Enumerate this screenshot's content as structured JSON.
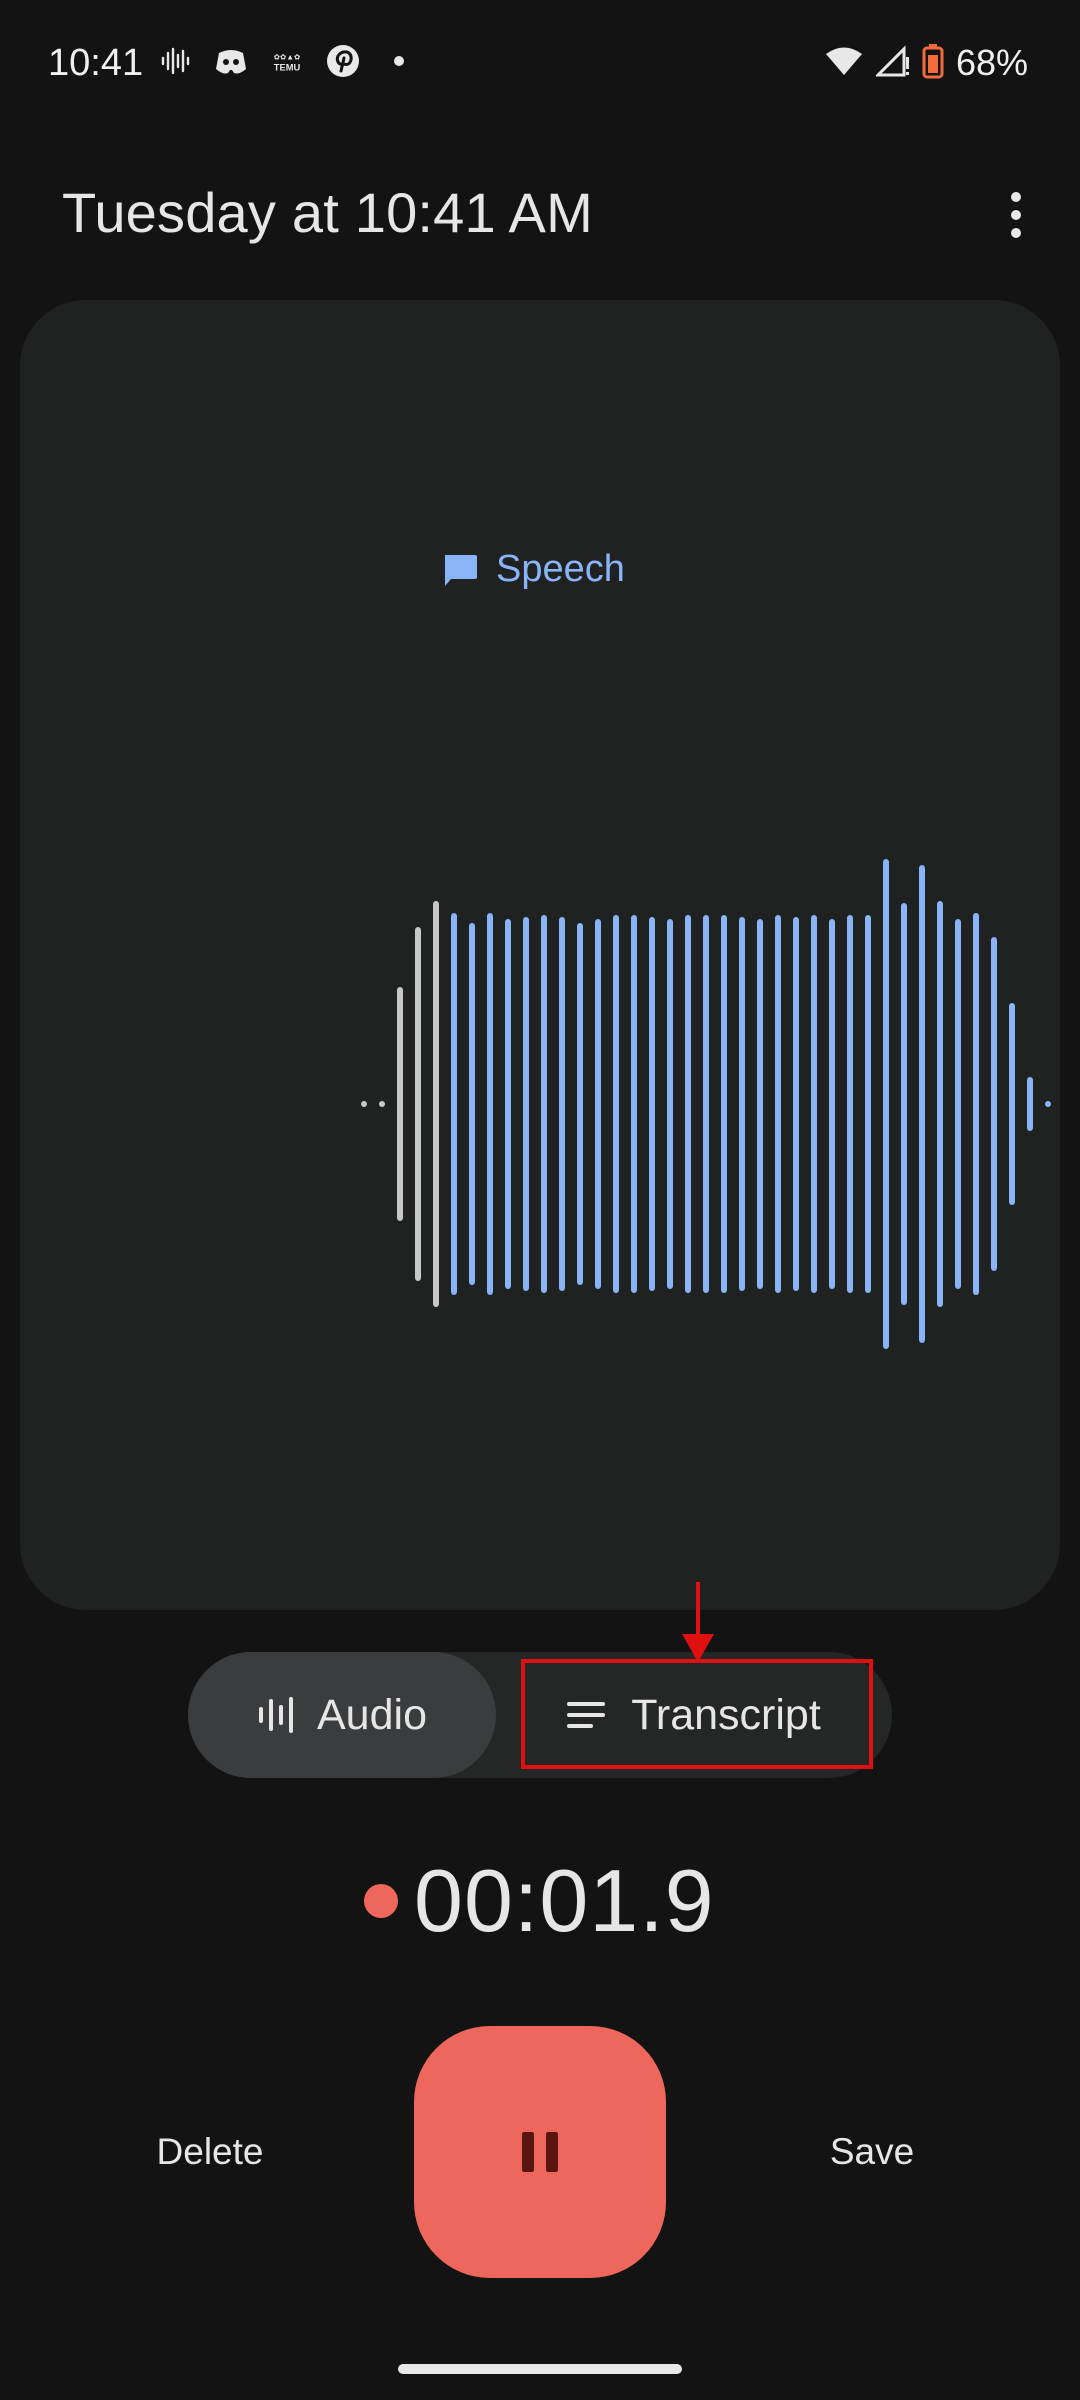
{
  "status_bar": {
    "time": "10:41",
    "battery": "68%",
    "icons_left": [
      "voice-recorder-icon",
      "discord-icon",
      "temu-icon",
      "pinterest-icon",
      "dot-icon"
    ],
    "icons_right": [
      "wifi-icon",
      "signal-icon",
      "battery-saver-icon"
    ]
  },
  "header": {
    "title": "Tuesday at 10:41 AM",
    "menu_icon": "more-vert-icon"
  },
  "waveform": {
    "label": "Speech",
    "label_color": "#8ab4f8",
    "played_color": "#8ab4f8",
    "unplayed_color": "#c8c8c8"
  },
  "mode_toggle": {
    "audio_label": "Audio",
    "transcript_label": "Transcript",
    "selected": "Audio"
  },
  "recorder": {
    "timer": "00:01.9",
    "delete_label": "Delete",
    "save_label": "Save",
    "accent": "#ee675c"
  }
}
